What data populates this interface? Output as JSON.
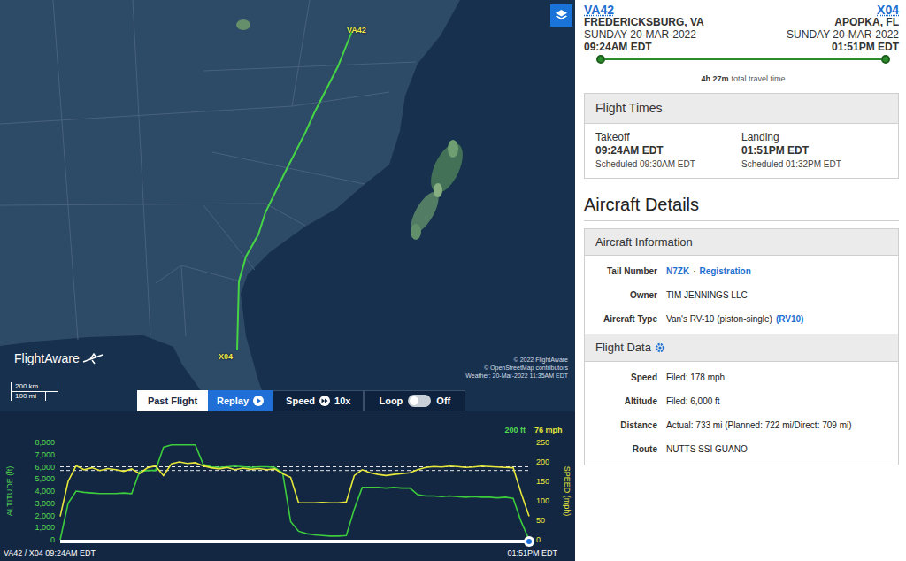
{
  "map": {
    "origin_label": "VA42",
    "destination_label": "X04",
    "logo": "FlightAware",
    "scale": [
      "200 km",
      "100 mi"
    ],
    "attribution": [
      "© 2022 FlightAware",
      "© OpenStreetMap contributors",
      "Weather: 20-Mar-2022 11:35AM EDT"
    ]
  },
  "controls": {
    "past_flight": {
      "label": "Past Flight",
      "selected": true
    },
    "replay": {
      "label": "Replay"
    },
    "speed": {
      "label": "Speed",
      "value": "10x"
    },
    "loop": {
      "label": "Loop",
      "on": false,
      "state_label": "Off"
    }
  },
  "chart": {
    "altitude_axis": {
      "title": "ALTITUDE (ft)",
      "ticks": [
        "8,000",
        "7,000",
        "6,000",
        "5,000",
        "4,000",
        "3,000",
        "2,000",
        "1,000",
        "0"
      ]
    },
    "speed_axis": {
      "title": "SPEED (mph)",
      "ticks": [
        "250",
        "200",
        "150",
        "100",
        "50",
        "0"
      ]
    },
    "altitude_ft": [
      0,
      3000,
      4000,
      3900,
      3850,
      3800,
      3800,
      3800,
      3850,
      3800,
      5600,
      5700,
      5700,
      7600,
      7800,
      7800,
      7800,
      7800,
      6200,
      6000,
      5950,
      6000,
      6050,
      6000,
      5950,
      6000,
      6000,
      5950,
      5500,
      1500,
      700,
      500,
      400,
      350,
      300,
      300,
      350,
      2500,
      4300,
      4300,
      4300,
      4250,
      4300,
      4250,
      4250,
      3700,
      3600,
      3600,
      3550,
      3600,
      3550,
      3500,
      3550,
      3500,
      3500,
      3450,
      3500,
      3400,
      1500,
      0
    ],
    "speed_mph": [
      60,
      150,
      190,
      180,
      185,
      178,
      183,
      180,
      176,
      182,
      170,
      185,
      190,
      165,
      195,
      200,
      196,
      198,
      190,
      185,
      182,
      186,
      180,
      184,
      181,
      183,
      180,
      182,
      170,
      160,
      95,
      95,
      95,
      96,
      95,
      95,
      97,
      165,
      180,
      172,
      168,
      165,
      168,
      170,
      172,
      180,
      186,
      188,
      187,
      189,
      188,
      186,
      187,
      189,
      188,
      187,
      186,
      185,
      120,
      60
    ],
    "filed_altitude_ft": 6000,
    "filed_speed_mph": 178,
    "cursor": {
      "altitude": "200 ft",
      "speed": "76 mph"
    },
    "start_label": "VA42 / X04 09:24AM EDT",
    "end_label": "01:51PM EDT",
    "progress": 1
  },
  "flight": {
    "origin": {
      "code": "VA42",
      "city": "FREDERICKSBURG, VA",
      "date": "SUNDAY 20-MAR-2022",
      "time": "09:24AM EDT"
    },
    "destination": {
      "code": "X04",
      "city": "APOPKA, FL",
      "date": "SUNDAY 20-MAR-2022",
      "time": "01:51PM EDT"
    },
    "progress": 1,
    "travel_time": "4h 27m",
    "travel_time_suffix": "total travel time",
    "flight_times": {
      "title": "Flight Times",
      "items": [
        {
          "label": "Takeoff",
          "time": "09:24AM EDT",
          "scheduled": "Scheduled 09:30AM EDT"
        },
        {
          "label": "Landing",
          "time": "01:51PM EDT",
          "scheduled": "Scheduled 01:32PM EDT"
        }
      ]
    },
    "aircraft_details": {
      "title": "Aircraft Details",
      "sections": [
        {
          "title": "Aircraft Information",
          "gear": false,
          "rows": [
            {
              "label": "Tail Number",
              "parts": [
                {
                  "text": "N7ZK",
                  "link": true
                },
                {
                  "text": "·",
                  "link": false
                },
                {
                  "text": "Registration",
                  "link": true
                }
              ]
            },
            {
              "label": "Owner",
              "parts": [
                {
                  "text": "TIM JENNINGS LLC",
                  "link": false
                }
              ]
            },
            {
              "label": "Aircraft Type",
              "parts": [
                {
                  "text": "Van's RV-10 (piston-single)",
                  "link": false
                },
                {
                  "text": "(RV10)",
                  "link": true
                }
              ]
            }
          ]
        },
        {
          "title": "Flight Data",
          "gear": true,
          "rows": [
            {
              "label": "Speed",
              "parts": [
                {
                  "text": "Filed: 178 mph",
                  "link": false
                }
              ]
            },
            {
              "label": "Altitude",
              "parts": [
                {
                  "text": "Filed: 6,000 ft",
                  "link": false
                }
              ]
            },
            {
              "label": "Distance",
              "parts": [
                {
                  "text": "Actual: 733 mi (Planned: 722 mi/Direct: 709 mi)",
                  "link": false
                }
              ]
            },
            {
              "label": "Route",
              "parts": [
                {
                  "text": "NUTTS SSI GUANO",
                  "link": false
                }
              ]
            }
          ]
        }
      ]
    }
  }
}
